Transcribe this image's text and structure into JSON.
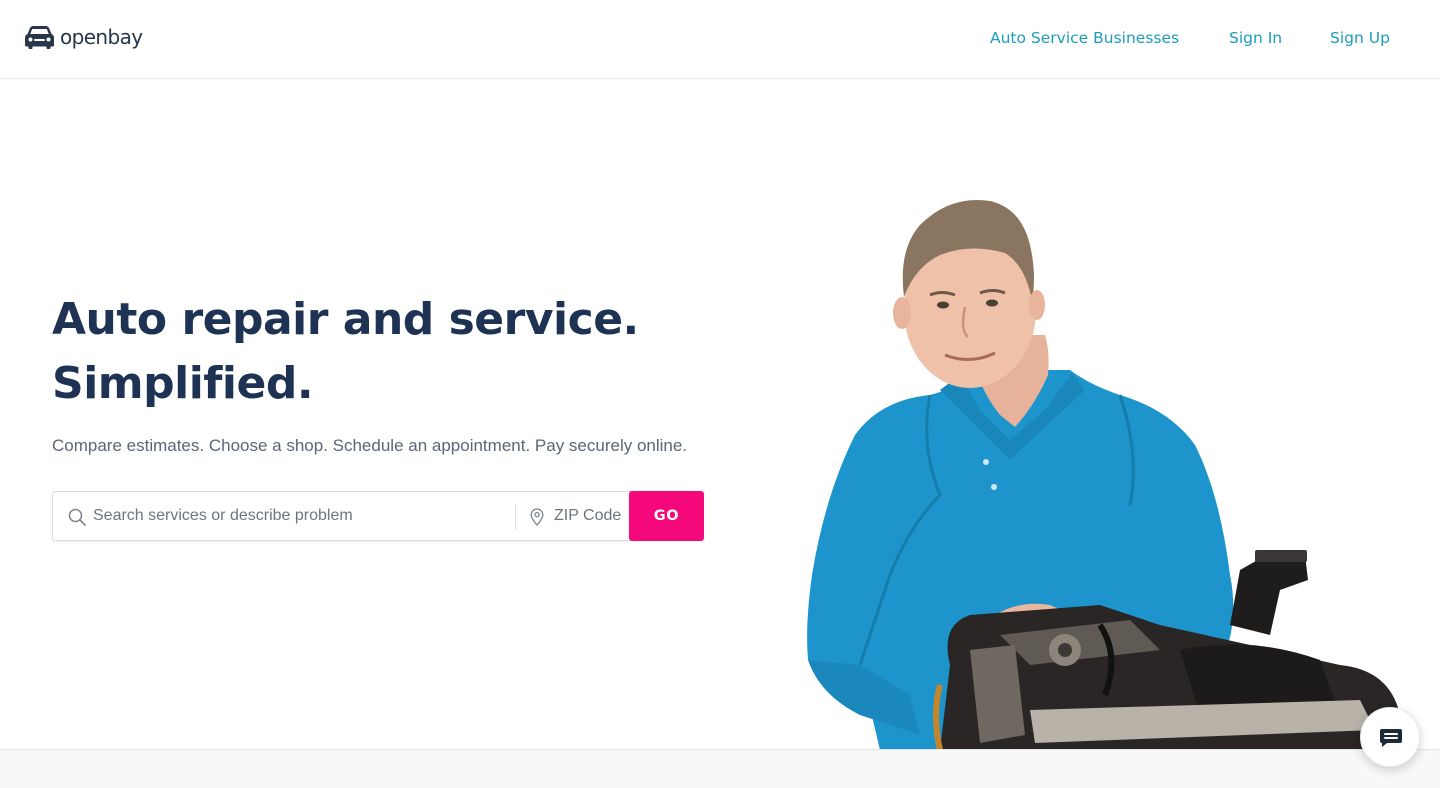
{
  "header": {
    "logo_text": "openbay",
    "logo_icon": "car-icon",
    "nav": {
      "businesses": "Auto Service Businesses",
      "sign_in": "Sign In",
      "sign_up": "Sign Up"
    }
  },
  "hero": {
    "title_line1": "Auto repair and service.",
    "title_line2": "Simplified.",
    "subtitle": "Compare estimates. Choose a shop. Schedule an appointment. Pay securely online.",
    "search": {
      "placeholder": "Search services or describe problem",
      "zip_placeholder": "ZIP Code",
      "go_label": "GO"
    }
  },
  "chat": {
    "icon": "chat-icon"
  },
  "colors": {
    "brand_navy": "#1e3354",
    "link_teal": "#1c9dbf",
    "cta_pink": "#f5087a",
    "shirt_blue": "#1d95cc"
  }
}
